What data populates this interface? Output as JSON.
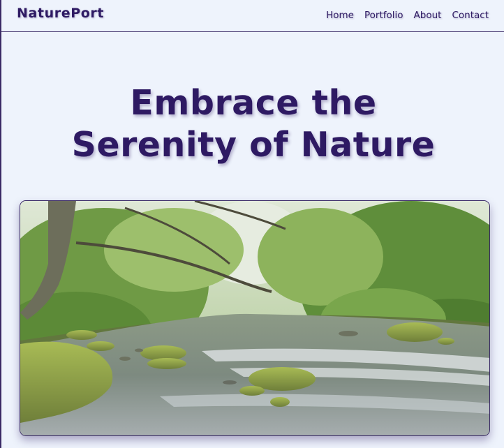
{
  "header": {
    "logo": "NaturePort",
    "nav": [
      "Home",
      "Portfolio",
      "About",
      "Contact"
    ]
  },
  "hero": {
    "title_line1": "Embrace the",
    "title_line2": "Serenity of Nature"
  },
  "image": {
    "subject": "forest river with mossy rocks"
  },
  "colors": {
    "background": "#eef3fc",
    "primary": "#2e1a63"
  }
}
